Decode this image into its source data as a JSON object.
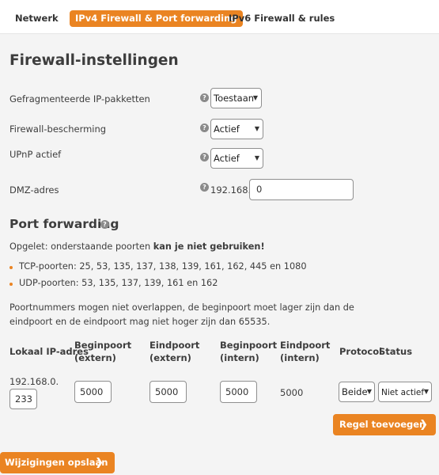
{
  "tabs": {
    "netwerk": "Netwerk",
    "ipv4": "IPv4 Firewall & Port forwarding",
    "ipv6": "IPv6 Firewall & rules"
  },
  "firewall": {
    "title": "Firewall-instellingen",
    "fragmented_label": "Gefragmenteerde IP-pakketten",
    "fragmented_value": "Toestaan",
    "protection_label": "Firewall-bescherming",
    "protection_value": "Actief",
    "upnp_label": "UPnP actief",
    "upnp_value": "Actief",
    "dmz_label": "DMZ-adres",
    "dmz_prefix": "192.168.0.",
    "dmz_value": "0",
    "help_glyph": "?"
  },
  "portforwarding": {
    "title": "Port forwarding",
    "note_prefix": "Opgelet: onderstaande poorten ",
    "note_bold": "kan je niet gebruiken!",
    "tcp": "TCP-poorten: 25, 53, 135, 137, 138, 139, 161, 162, 445 en 1080",
    "udp": "UDP-poorten: 53, 135, 137, 139, 161 en 162",
    "info_line1": "Poortnummers mogen niet overlappen, de beginpoort moet lager zijn dan de",
    "info_line2": "eindpoort en de eindpoort mag niet hoger zijn dan 65535.",
    "columns": {
      "local_ip": "Lokaal IP-adres",
      "start_ext_1": "Beginpoort",
      "start_ext_2": "(extern)",
      "end_ext_1": "Eindpoort",
      "end_ext_2": "(extern)",
      "start_int_1": "Beginpoort",
      "start_int_2": "(intern)",
      "end_int_1": "Eindpoort",
      "end_int_2": "(intern)",
      "protocol": "Protocol",
      "status": "Status"
    },
    "row": {
      "ip_prefix": "192.168.0.",
      "ip_suffix": "233",
      "start_ext": "5000",
      "end_ext": "5000",
      "start_int": "5000",
      "end_int": "5000",
      "protocol": "Beide",
      "status": "Niet actief"
    },
    "add_rule": "Regel toevoegen"
  },
  "save": "Wijzigingen opslaan",
  "icons": {
    "chevron_down": "chevron-down-icon",
    "chevron_right": "chevron-right-icon",
    "help": "help-icon"
  },
  "colors": {
    "accent": "#ea8422",
    "background": "#f4f4f4"
  }
}
